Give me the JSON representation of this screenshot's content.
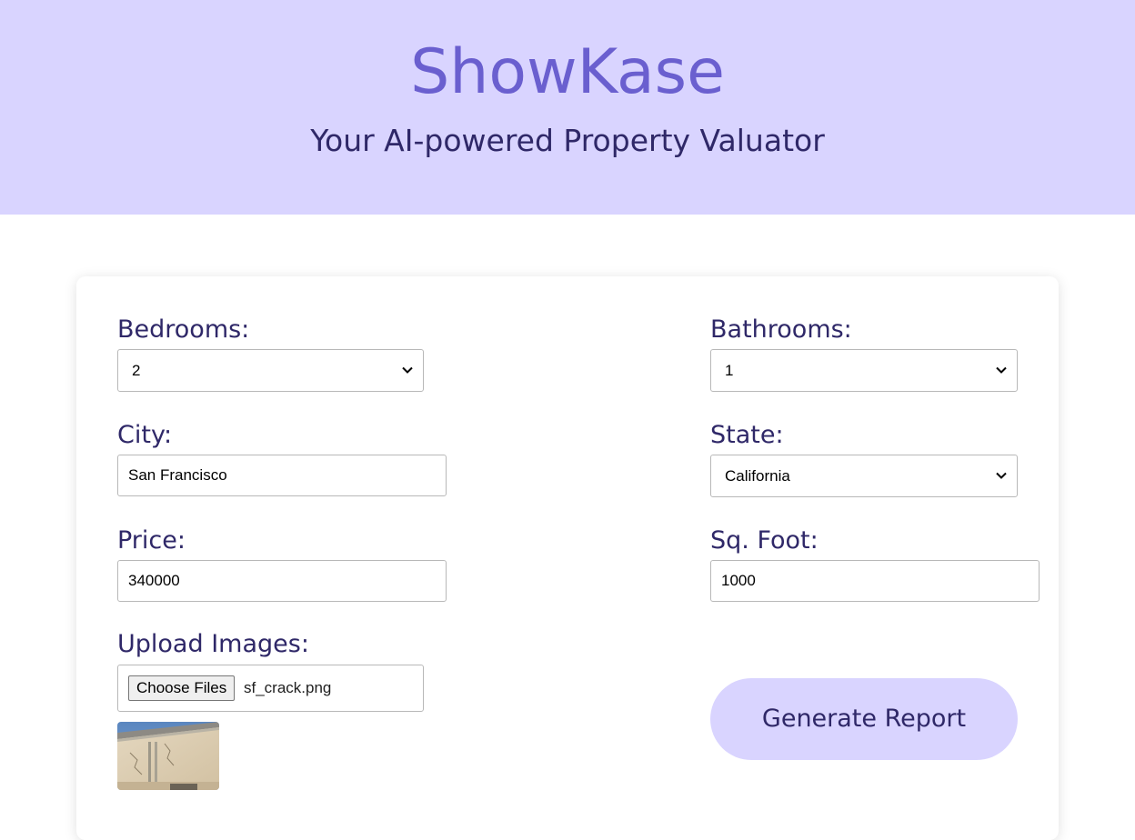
{
  "header": {
    "brand": "ShowKase",
    "tagline": "Your AI-powered Property Valuator"
  },
  "form": {
    "bedrooms": {
      "label": "Bedrooms:",
      "value": "2"
    },
    "bathrooms": {
      "label": "Bathrooms:",
      "value": "1"
    },
    "city": {
      "label": "City:",
      "value": "San Francisco"
    },
    "state": {
      "label": "State:",
      "value": "California"
    },
    "price": {
      "label": "Price:",
      "value": "340000"
    },
    "sqft": {
      "label": "Sq. Foot:",
      "value": "1000"
    },
    "upload": {
      "label": "Upload Images:",
      "button_label": "Choose Files",
      "file_name": "sf_crack.png"
    },
    "submit_label": "Generate Report"
  },
  "colors": {
    "header_bg": "#d9d4ff",
    "brand": "#6a5fcf",
    "label_text": "#2f2868",
    "button_bg": "#d9d4ff"
  },
  "icons": {
    "select_arrow": "chevron-down-icon",
    "image_preview": "uploaded-image-thumbnail"
  }
}
